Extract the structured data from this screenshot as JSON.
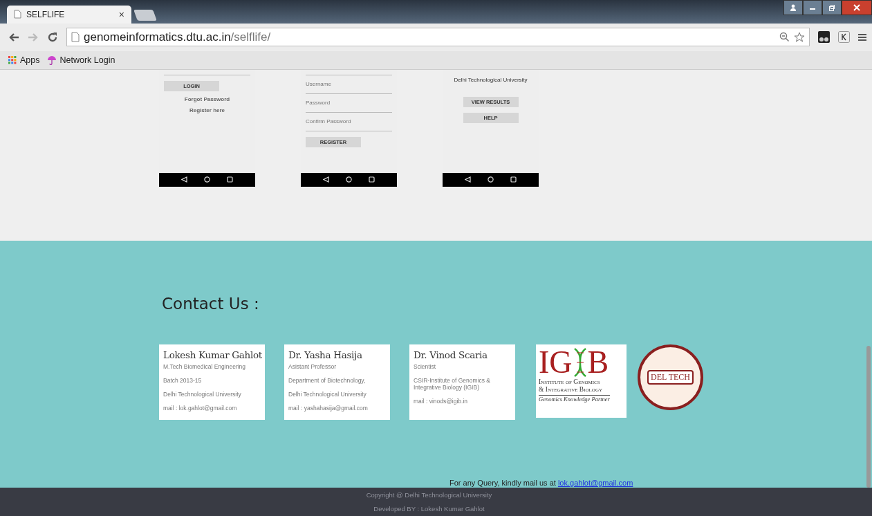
{
  "browser": {
    "tabs": [
      {
        "title": "SELFLIFE",
        "close": "×",
        "selected": true
      },
      {
        "selected": false
      }
    ],
    "address_bar": {
      "host": "genomeinformatics.dtu.ac.in",
      "path": "/selflife/"
    },
    "back_disabled": false,
    "forward_disabled": true,
    "bookmarks": [
      {
        "label": "Apps",
        "kind": "apps"
      },
      {
        "label": "Network Login",
        "kind": "umbrella"
      }
    ]
  },
  "phones": [
    {
      "items": [
        {
          "kind": "field"
        },
        {
          "kind": "button",
          "label": "LOGIN",
          "wide": true
        },
        {
          "kind": "link",
          "label": "Forgot Password"
        },
        {
          "kind": "link",
          "label": "Register here"
        }
      ]
    },
    {
      "items": [
        {
          "kind": "field"
        },
        {
          "kind": "field",
          "label": "Username"
        },
        {
          "kind": "field",
          "label": "Password"
        },
        {
          "kind": "field",
          "label": "Confirm Password"
        },
        {
          "kind": "button",
          "label": "REGISTER",
          "wide": true
        }
      ]
    },
    {
      "items": [
        {
          "kind": "heading",
          "label": "Delhi Technological University"
        },
        {
          "kind": "button",
          "label": "VIEW RESULTS",
          "wide": false
        },
        {
          "kind": "button",
          "label": "HELP",
          "wide": false
        }
      ]
    }
  ],
  "contact": {
    "title": "Contact Us :",
    "cards": [
      {
        "name": "Lokesh Kumar Gahlot",
        "lines": [
          "M.Tech Biomedical Engineering",
          "Batch 2013-15",
          "Delhi Technological University",
          "mail : lok.gahlot@gmail.com"
        ]
      },
      {
        "name": "Dr. Yasha Hasija",
        "lines": [
          "Asistant Professor",
          "Department of Biotechnology,",
          "Delhi Technological University",
          "mail : yashahasija@gmail.com"
        ]
      },
      {
        "name": "Dr. Vinod Scaria",
        "lines": [
          "Scientist",
          "CSIR-Institute of Genomics & Integrative Biology (IGIB)",
          "mail : vinods@igib.in"
        ]
      }
    ],
    "igib_logo": {
      "letters": "IG",
      "letters_end": "B",
      "line1": "Institute of Genomics",
      "line2": "& Integrative Biology",
      "tagline": "Genomics Knowledge Partner"
    },
    "seal": {
      "text": "DEL TECH"
    },
    "query": {
      "text": "For any Query, kindly mail us at",
      "link": "lok.gahlot@gmail.com"
    }
  },
  "footer": {
    "lines": [
      "Copyright @ Delhi Technological University",
      "Developed BY : Lokesh Kumar Gahlot"
    ]
  }
}
